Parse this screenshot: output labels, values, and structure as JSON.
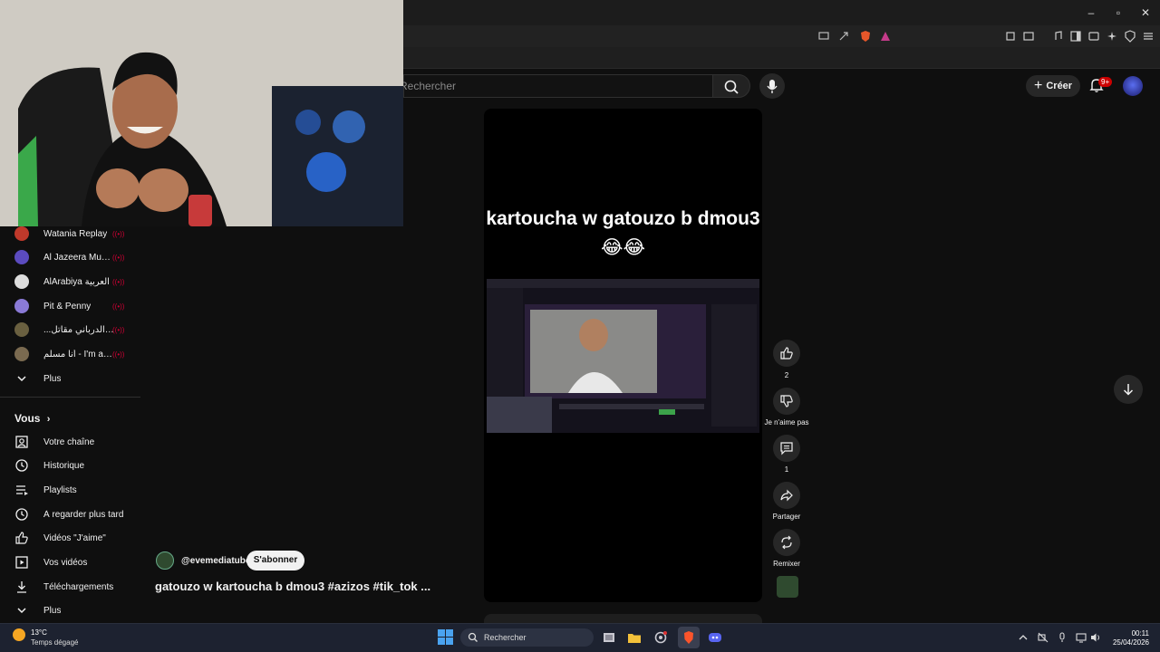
{
  "youtube": {
    "search_placeholder": "Rechercher",
    "create_label": "Créer",
    "notif_badge": "9+"
  },
  "sidebar": {
    "channels": [
      {
        "name": "Watania Replay",
        "color": "#c0392b"
      },
      {
        "name": "Al Jazeera Muba...",
        "color": "#5b4bbf"
      },
      {
        "name": "AlArabiya العربية",
        "color": "#dddddd"
      },
      {
        "name": "Pit & Penny",
        "color": "#8a7ad6"
      },
      {
        "name": "...مباشر بث الدرباني مقاتل",
        "color": "#6a6040"
      },
      {
        "name": "أنا مسلم - I'm a Mus...",
        "color": "#7a6a50"
      }
    ],
    "more_label": "Plus",
    "you_label": "Vous",
    "you_items": [
      {
        "label": "Votre chaîne",
        "icon": "channel-icon"
      },
      {
        "label": "Historique",
        "icon": "history-icon"
      },
      {
        "label": "Playlists",
        "icon": "playlist-icon"
      },
      {
        "label": "À regarder plus tard",
        "icon": "clock-icon"
      },
      {
        "label": "Vidéos \"J'aime\"",
        "icon": "thumb-up-icon"
      },
      {
        "label": "Vos vidéos",
        "icon": "video-icon"
      },
      {
        "label": "Téléchargements",
        "icon": "download-icon"
      }
    ],
    "more_label_2": "Plus"
  },
  "short": {
    "overlay_title": "kartoucha w gatouzo b dmou3😂😂",
    "channel": "@evemediatube",
    "subscribe_label": "S'abonner",
    "title": "gatouzo w kartoucha b dmou3 #azizos #tik_tok ...",
    "likes": "2",
    "dislike_label": "Je n'aime pas",
    "comments": "1",
    "share_label": "Partager",
    "remix_label": "Remixer"
  },
  "taskbar": {
    "temp": "13°C",
    "weather": "Temps dégagé",
    "search_label": "Rechercher",
    "time": "00:11",
    "date": "25/04/2026"
  }
}
